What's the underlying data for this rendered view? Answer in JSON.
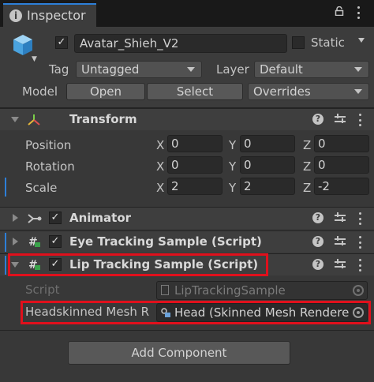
{
  "tab": {
    "title": "Inspector",
    "icon": "info-icon"
  },
  "header": {
    "object_name": "Avatar_Shieh_V2",
    "static_label": "Static",
    "tag_label": "Tag",
    "tag_value": "Untagged",
    "layer_label": "Layer",
    "layer_value": "Default",
    "model_label": "Model",
    "open_label": "Open",
    "select_label": "Select",
    "overrides_label": "Overrides"
  },
  "transform": {
    "title": "Transform",
    "rows": [
      {
        "label": "Position",
        "x": "0",
        "y": "0",
        "z": "0"
      },
      {
        "label": "Rotation",
        "x": "0",
        "y": "0",
        "z": "0"
      },
      {
        "label": "Scale",
        "x": "2",
        "y": "2",
        "z": "-2"
      }
    ],
    "axis": {
      "x": "X",
      "y": "Y",
      "z": "Z"
    }
  },
  "components": {
    "animator": "Animator",
    "eye": "Eye Tracking Sample (Script)",
    "lip": "Lip Tracking Sample (Script)"
  },
  "lip_fields": {
    "script_label": "Script",
    "script_value": "LipTrackingSample",
    "mesh_label": "Headskinned Mesh R",
    "mesh_value": "Head (Skinned Mesh Rendere"
  },
  "footer": {
    "add_component": "Add Component"
  },
  "colors": {
    "accent": "#2d7fd8",
    "highlight": "#e0101c",
    "background": "#383838"
  }
}
